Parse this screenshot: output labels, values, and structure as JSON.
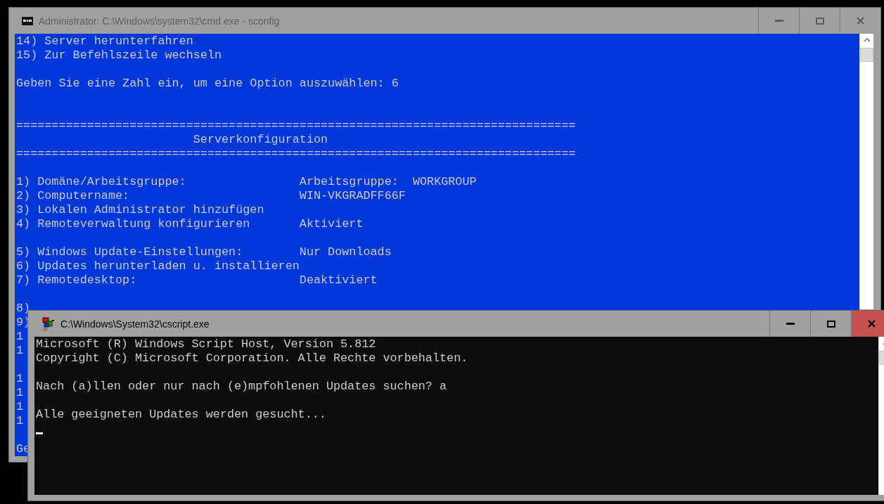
{
  "windows": [
    {
      "title": "Administrator: C:\\Windows\\system32\\cmd.exe - sconfig",
      "kind": "terminal",
      "active": false,
      "color": "#0037da",
      "blocks": [
        {
          "kind": "text",
          "lines": [
            "14) Server herunterfahren",
            "15) Zur Befehlszeile wechseln"
          ]
        },
        {
          "kind": "text",
          "lines": [
            "Geben Sie eine Zahl ein, um eine Option auszuwählen: 6"
          ]
        },
        {
          "kind": "banner",
          "lines": [
            "===============================================================================",
            "                         Serverkonfiguration",
            "==============================================================================="
          ]
        },
        {
          "kind": "text",
          "lines": [
            "1) Domäne/Arbeitsgruppe:                Arbeitsgruppe:  WORKGROUP",
            "2) Computername:                        WIN-VKGRADFF66F",
            "3) Lokalen Administrator hinzufügen",
            "4) Remoteverwaltung konfigurieren       Aktiviert"
          ]
        },
        {
          "kind": "text",
          "lines": [
            "5) Windows Update-Einstellungen:        Nur Downloads",
            "6) Updates herunterladen u. installieren",
            "7) Remotedesktop:                       Deaktiviert"
          ]
        },
        {
          "kind": "text",
          "lines": [
            "8)",
            "9)",
            "1",
            "1"
          ]
        },
        {
          "kind": "text",
          "lines": [
            "1",
            "1",
            "1",
            "1"
          ]
        },
        {
          "kind": "text",
          "lines": [
            "Ge"
          ]
        }
      ]
    },
    {
      "title": "C:\\Windows\\System32\\cscript.exe",
      "kind": "script",
      "active": true,
      "color": "#0c0c0c",
      "cursor": true,
      "blocks": [
        {
          "kind": "text",
          "lines": [
            "Microsoft (R) Windows Script Host, Version 5.812",
            "Copyright (C) Microsoft Corporation. Alle Rechte vorbehalten."
          ]
        },
        {
          "kind": "text",
          "lines": [
            "Nach (a)llen oder nur nach (e)mpfohlenen Updates suchen? a"
          ]
        },
        {
          "kind": "text",
          "lines": [
            "Alle geeigneten Updates werden gesucht..."
          ]
        }
      ]
    }
  ]
}
